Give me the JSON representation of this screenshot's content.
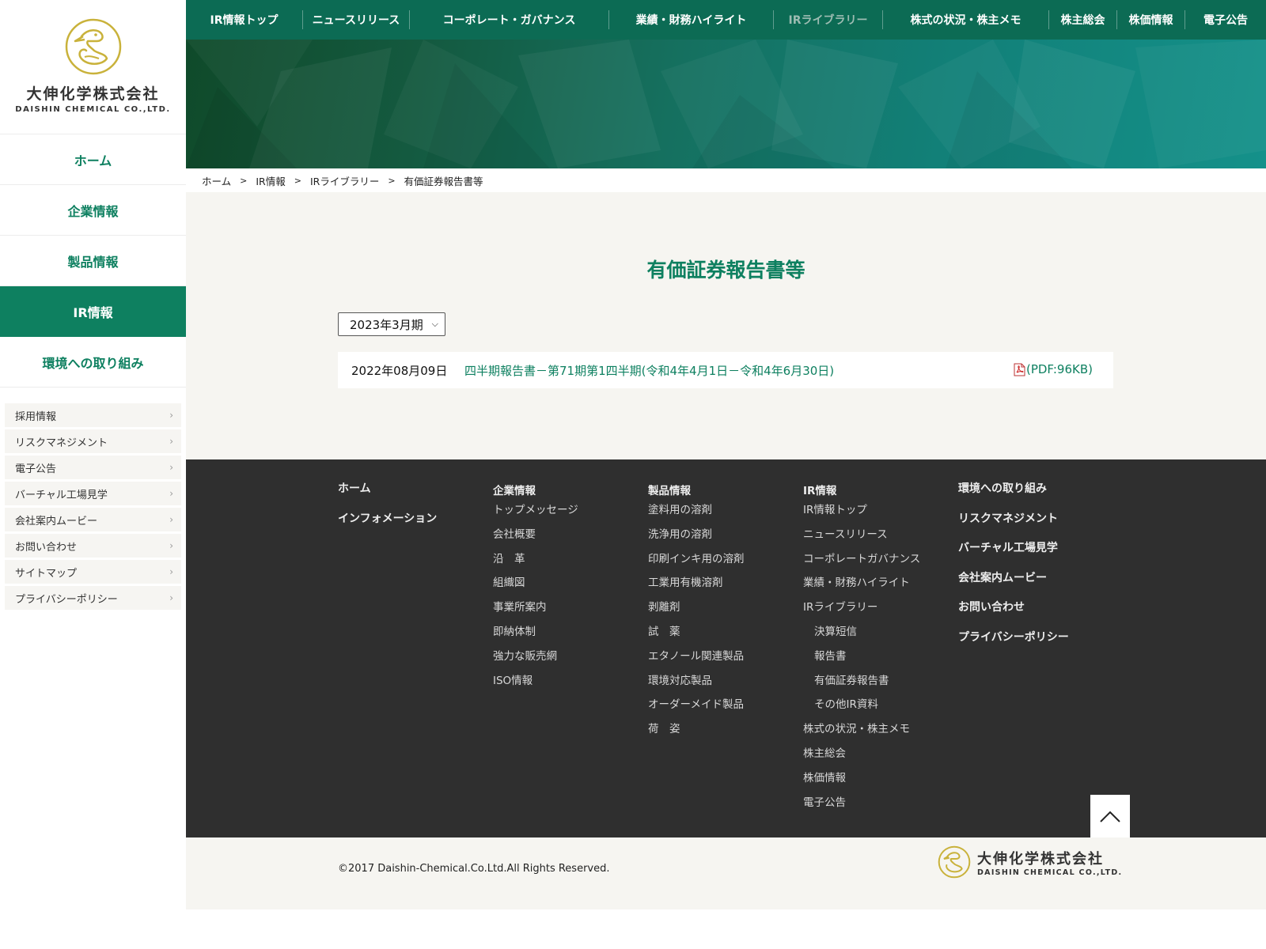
{
  "brand": {
    "name_jp": "大伸化学株式会社",
    "name_en": "DAISHIN CHEMICAL CO.,LTD.",
    "accent_color": "#0e8060",
    "topnav_color": "#0c6b54",
    "logo_color": "#c9b23b"
  },
  "sidebar": {
    "main_items": [
      {
        "label": "ホーム",
        "active": false
      },
      {
        "label": "企業情報",
        "active": false
      },
      {
        "label": "製品情報",
        "active": false
      },
      {
        "label": "IR情報",
        "active": true
      },
      {
        "label": "環境への取り組み",
        "active": false
      }
    ],
    "sub_items": [
      {
        "label": "採用情報"
      },
      {
        "label": "リスクマネジメント"
      },
      {
        "label": "電子公告"
      },
      {
        "label": "バーチャル工場見学"
      },
      {
        "label": "会社案内ムービー"
      },
      {
        "label": "お問い合わせ"
      },
      {
        "label": "サイトマップ"
      },
      {
        "label": "プライバシーポリシー"
      }
    ]
  },
  "topnav": {
    "items": [
      {
        "label": "IR情報トップ"
      },
      {
        "label": "ニュースリリース"
      },
      {
        "label": "コーポレート・ガバナンス"
      },
      {
        "label": "業績・財務ハイライト"
      },
      {
        "label": "IRライブラリー",
        "current": true
      },
      {
        "label": "株式の状況・株主メモ"
      },
      {
        "label": "株主総会"
      },
      {
        "label": "株価情報"
      },
      {
        "label": "電子公告"
      }
    ]
  },
  "breadcrumb": {
    "items": [
      "ホーム",
      "IR情報",
      "IRライブラリー",
      "有価証券報告書等"
    ],
    "separator": ">"
  },
  "main": {
    "title": "有価証券報告書等",
    "period_select": {
      "value": "2023年3月期"
    },
    "reports": [
      {
        "date": "2022年08月09日",
        "title": "四半期報告書－第71期第1四半期(令和4年4月1日－令和4年6月30日)",
        "pdf": "(PDF:96KB)"
      }
    ]
  },
  "footer": {
    "col1": {
      "items": [
        "ホーム",
        "インフォメーション"
      ]
    },
    "col2": {
      "heading": "企業情報",
      "links": [
        "トップメッセージ",
        "会社概要",
        "沿　革",
        "組織図",
        "事業所案内",
        "即納体制",
        "強力な販売網",
        "ISO情報"
      ]
    },
    "col3": {
      "heading": "製品情報",
      "links": [
        "塗料用の溶剤",
        "洗浄用の溶剤",
        "印刷インキ用の溶剤",
        "工業用有機溶剤",
        "剥離剤",
        "試　薬",
        "エタノール関連製品",
        "環境対応製品",
        "オーダーメイド製品",
        "荷　姿"
      ]
    },
    "col4": {
      "heading": "IR情報",
      "links": [
        "IR情報トップ",
        "ニュースリリース",
        "コーポレートガバナンス",
        "業績・財務ハイライト",
        "IRライブラリー",
        "決算短信",
        "報告書",
        "有価証券報告書",
        "その他IR資料",
        "株式の状況・株主メモ",
        "株主総会",
        "株価情報",
        "電子公告"
      ]
    },
    "col5": {
      "items": [
        "環境への取り組み",
        "リスクマネジメント",
        "バーチャル工場見学",
        "会社案内ムービー",
        "お問い合わせ",
        "プライバシーポリシー"
      ]
    },
    "copyright": "©2017 Daishin-Chemical.Co.Ltd.All Rights Reserved."
  }
}
